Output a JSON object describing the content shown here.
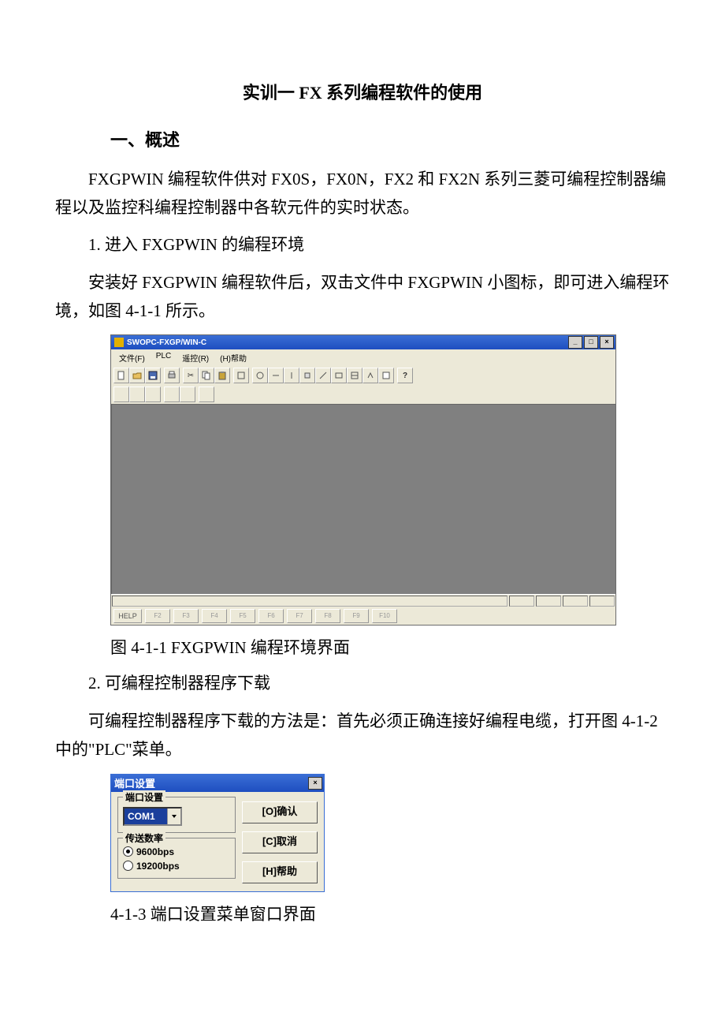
{
  "doc": {
    "title": "实训一 FX 系列编程软件的使用",
    "section1": "一、概述",
    "p1": "FXGPWIN 编程软件供对 FX0S，FX0N，FX2 和 FX2N 系列三菱可编程控制器编程以及监控科编程控制器中各软元件的实时状态。",
    "p2": "1. 进入 FXGPWIN 的编程环境",
    "p3": "安装好 FXGPWIN 编程软件后，双击文件中 FXGPWIN 小图标，即可进入编程环境，如图 4-1-1 所示。",
    "cap1": "图 4-1-1 FXGPWIN 编程环境界面",
    "p4": "2. 可编程控制器程序下载",
    "p5": "可编程控制器程序下载的方法是：首先必须正确连接好编程电缆，打开图 4-1-2 中的\"PLC\"菜单。",
    "cap2": "4-1-3 端口设置菜单窗口界面"
  },
  "app": {
    "title": "SWOPC-FXGP/WIN-C",
    "menu": [
      "文件(F)",
      "PLC",
      "遥控(R)",
      "(H)帮助"
    ],
    "help_key": "HELP",
    "fkeys": [
      "F2",
      "F3",
      "F4",
      "F5",
      "F6",
      "F7",
      "F8",
      "F9",
      "F10"
    ]
  },
  "dlg": {
    "title": "端口设置",
    "group_port": "端口设置",
    "combo_value": "COM1",
    "group_baud": "传送数率",
    "opt1": "9600bps",
    "opt2": "19200bps",
    "btn_ok": "[O]确认",
    "btn_cancel": "[C]取消",
    "btn_help": "[H]帮助"
  }
}
